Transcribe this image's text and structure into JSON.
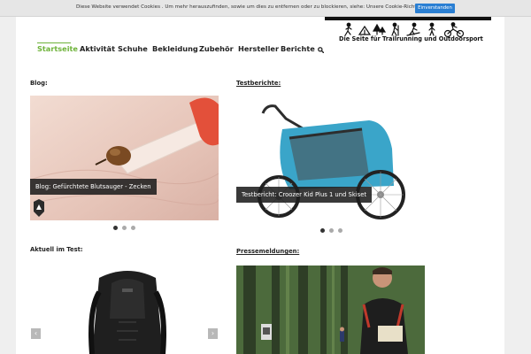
{
  "cookie_bar": {
    "text": "Diese Website verwendet Cookies . Um mehr herauszufinden, sowie um dies zu entfernen oder zu blockieren, siehe: Unsere Cookie-Richtlinie",
    "accept_label": "Einverstanden"
  },
  "header": {
    "tagline": "Die Seite für Trailrunning und Outdoorsport"
  },
  "nav": {
    "items": [
      {
        "label": "Startseite",
        "active": true
      },
      {
        "label": "Aktivität"
      },
      {
        "label": "Schuhe"
      },
      {
        "label": "Bekleidung"
      },
      {
        "label": "Zubehör"
      },
      {
        "label": "Hersteller"
      },
      {
        "label": "Berichte"
      }
    ],
    "search_icon": "search-icon"
  },
  "sections": {
    "blog": {
      "heading": "Blog:",
      "caption": "Blog: Gefürchtete Blutsauger - Zecken",
      "dots": 3,
      "active_dot": 0
    },
    "tests": {
      "heading": "Testberichte:",
      "caption": "Testbericht: Croozer Kid Plus 1 und Skiset",
      "dots": 3,
      "active_dot": 0
    },
    "current": {
      "heading": "Aktuell im Test:",
      "prev_icon": "chevron-left-icon",
      "next_icon": "chevron-right-icon"
    },
    "press": {
      "heading": "Pressemeldungen:"
    }
  },
  "colors": {
    "accent": "#6fb33b",
    "cookie_button": "#2a7fd3",
    "trailer_frame": "#3aa5c9"
  }
}
